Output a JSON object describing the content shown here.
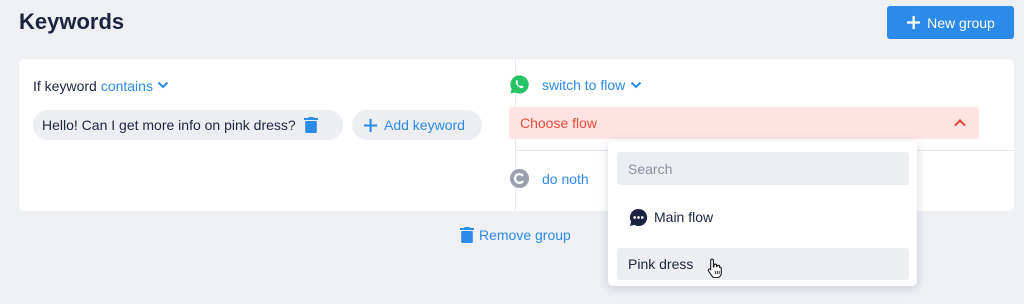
{
  "header": {
    "title": "Keywords",
    "new_group_label": "New group"
  },
  "rule": {
    "condition_prefix": "If keyword",
    "condition_operator": "contains",
    "keyword": "Hello! Can I get more info on pink dress?",
    "add_keyword_label": "Add keyword"
  },
  "action": {
    "channel_icon": "whatsapp-icon",
    "action_label": "switch to flow",
    "flow_select_placeholder": "Choose flow",
    "fallback_label": "do noth"
  },
  "remove_group_label": "Remove group",
  "dropdown": {
    "search_placeholder": "Search",
    "items": [
      {
        "label": "Main flow",
        "icon": "chat-bubble-icon"
      },
      {
        "label": "Pink dress",
        "icon": ""
      }
    ]
  },
  "colors": {
    "accent": "#2c8ae8",
    "error_bg": "#fde3e1",
    "error_text": "#ec4c3c",
    "whatsapp": "#25c366"
  }
}
